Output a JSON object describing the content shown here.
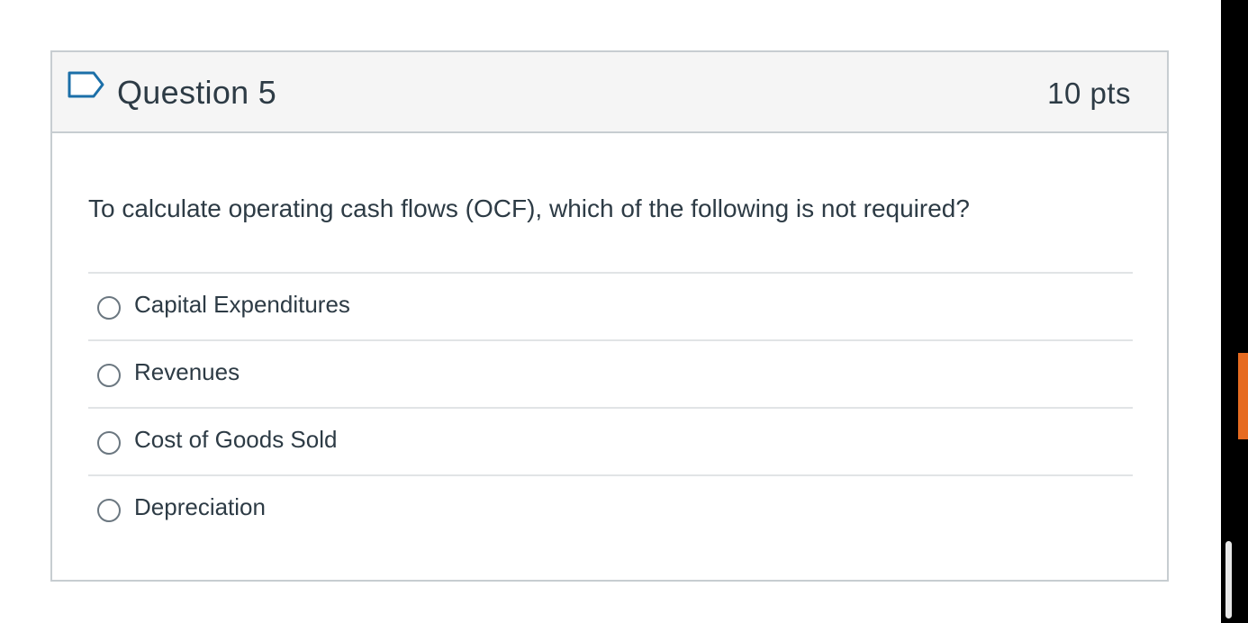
{
  "question": {
    "title": "Question 5",
    "points": "10 pts",
    "prompt": "To calculate operating cash flows (OCF), which of the following is not required?",
    "answers": [
      {
        "label": "Capital Expenditures"
      },
      {
        "label": "Revenues"
      },
      {
        "label": "Cost of Goods Sold"
      },
      {
        "label": "Depreciation"
      }
    ]
  },
  "colors": {
    "header_bg": "#f5f5f5",
    "border": "#c7cdd1",
    "text": "#2d3b45",
    "accent_tab": "#e66b21",
    "side_bar": "#000000"
  },
  "icons": {
    "flag": "flag-bookmark-icon",
    "radio": "radio-unselected-icon"
  }
}
